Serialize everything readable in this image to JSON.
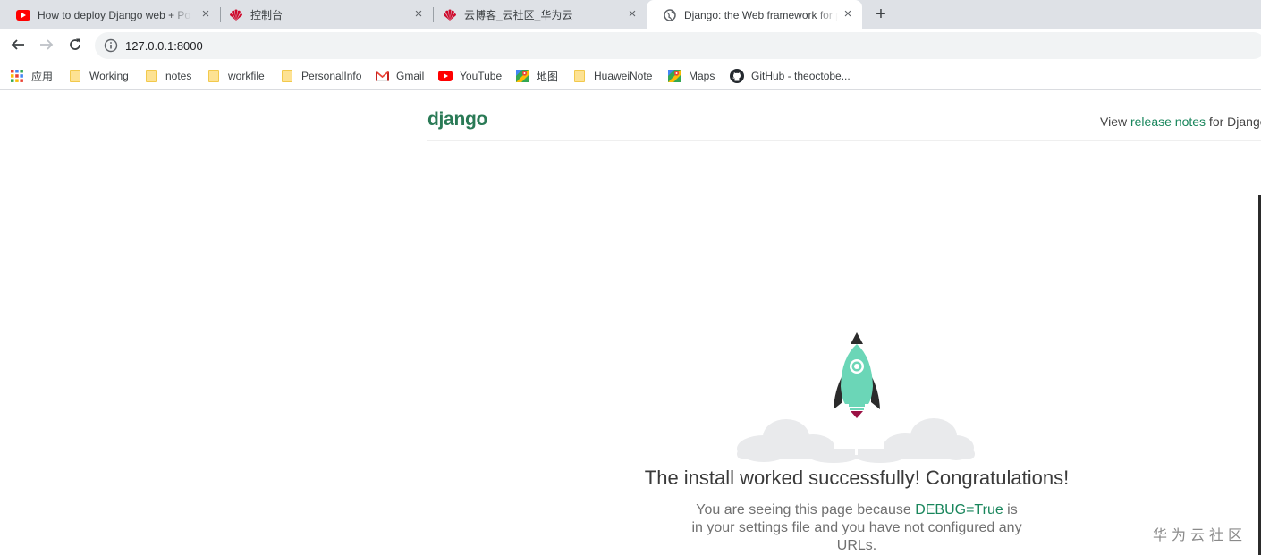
{
  "tabs": [
    {
      "title": "How to deploy Django web + Postgres",
      "favicon": "youtube-icon",
      "close": "×"
    },
    {
      "title": "控制台",
      "favicon": "huawei-icon",
      "close": "×"
    },
    {
      "title": "云博客_云社区_华为云",
      "favicon": "huawei-icon",
      "close": "×"
    },
    {
      "title": "Django: the Web framework for perfectionists",
      "favicon": "globe-icon",
      "close": "×"
    }
  ],
  "new_tab_label": "+",
  "address_bar": {
    "url": "127.0.0.1:8000"
  },
  "bookmarks": [
    {
      "label": "应用",
      "icon": "apps-grid-icon"
    },
    {
      "label": "Working",
      "icon": "folder-icon"
    },
    {
      "label": "notes",
      "icon": "folder-icon"
    },
    {
      "label": "workfile",
      "icon": "folder-icon"
    },
    {
      "label": "PersonalInfo",
      "icon": "folder-icon"
    },
    {
      "label": "Gmail",
      "icon": "gmail-icon"
    },
    {
      "label": "YouTube",
      "icon": "youtube-icon"
    },
    {
      "label": "地图",
      "icon": "maps-icon"
    },
    {
      "label": "HuaweiNote",
      "icon": "folder-icon"
    },
    {
      "label": "Maps",
      "icon": "maps-icon"
    },
    {
      "label": "GitHub - theoctobe...",
      "icon": "github-icon"
    }
  ],
  "page": {
    "logo": "django",
    "release_prefix": "View ",
    "release_link": "release notes",
    "release_suffix": " for Django",
    "headline": "The install worked successfully! Congratulations!",
    "sub_1": "You are seeing this page because ",
    "debug": "DEBUG=True",
    "sub_2": " is in your settings file and you have not configured any URLs."
  },
  "watermark": "华为云社区",
  "colors": {
    "django_green": "#19865c",
    "tab_strip": "#dee1e6",
    "rocket": "#6bd6b7"
  }
}
